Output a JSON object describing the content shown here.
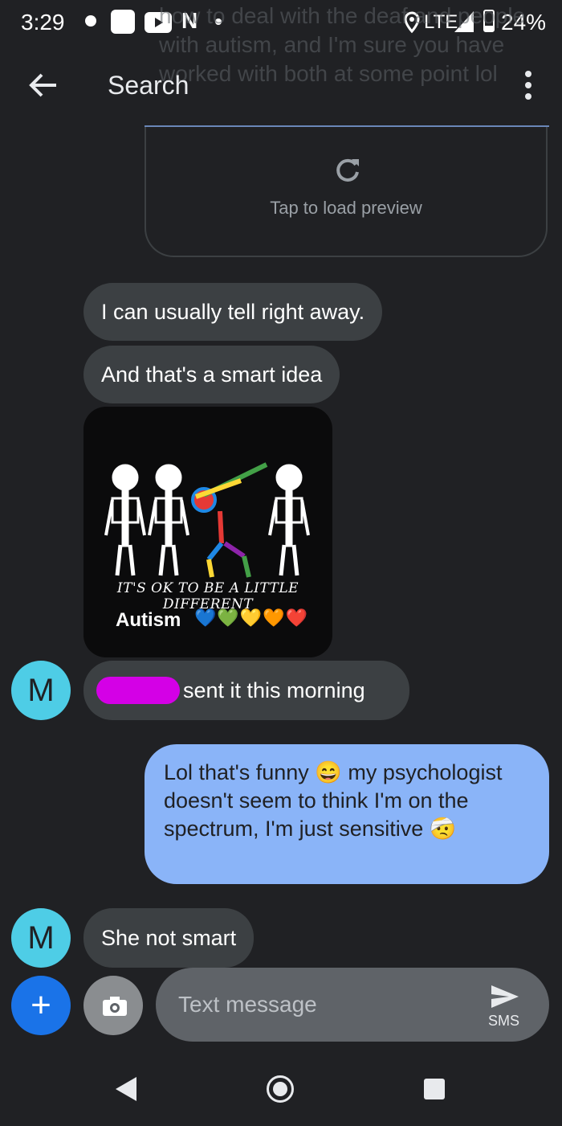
{
  "status_bar": {
    "time": "3:29",
    "network": "LTE",
    "battery": "24%",
    "notif_letter": "N"
  },
  "toolbar": {
    "title": "Search"
  },
  "background_text": "how to deal with the deaf and people with autism, and I'm sure you have worked with both at some point lol",
  "link_preview": {
    "label": "Tap to load preview"
  },
  "messages": {
    "m1": "I can usually tell right away.",
    "m2": "And that's a smart idea",
    "image": {
      "caption": "IT'S OK TO BE A LITTLE DIFFERENT",
      "title": "Autism",
      "hearts": "💙💚💛🧡❤️"
    },
    "m3": "sent it this morning",
    "sent": "Lol that's funny 😄 my psychologist doesn't seem to think I'm on the spectrum, I'm just sensitive 🤕",
    "m4": "She not smart"
  },
  "avatar_letter": "M",
  "compose": {
    "placeholder": "Text message",
    "send_label": "SMS"
  }
}
